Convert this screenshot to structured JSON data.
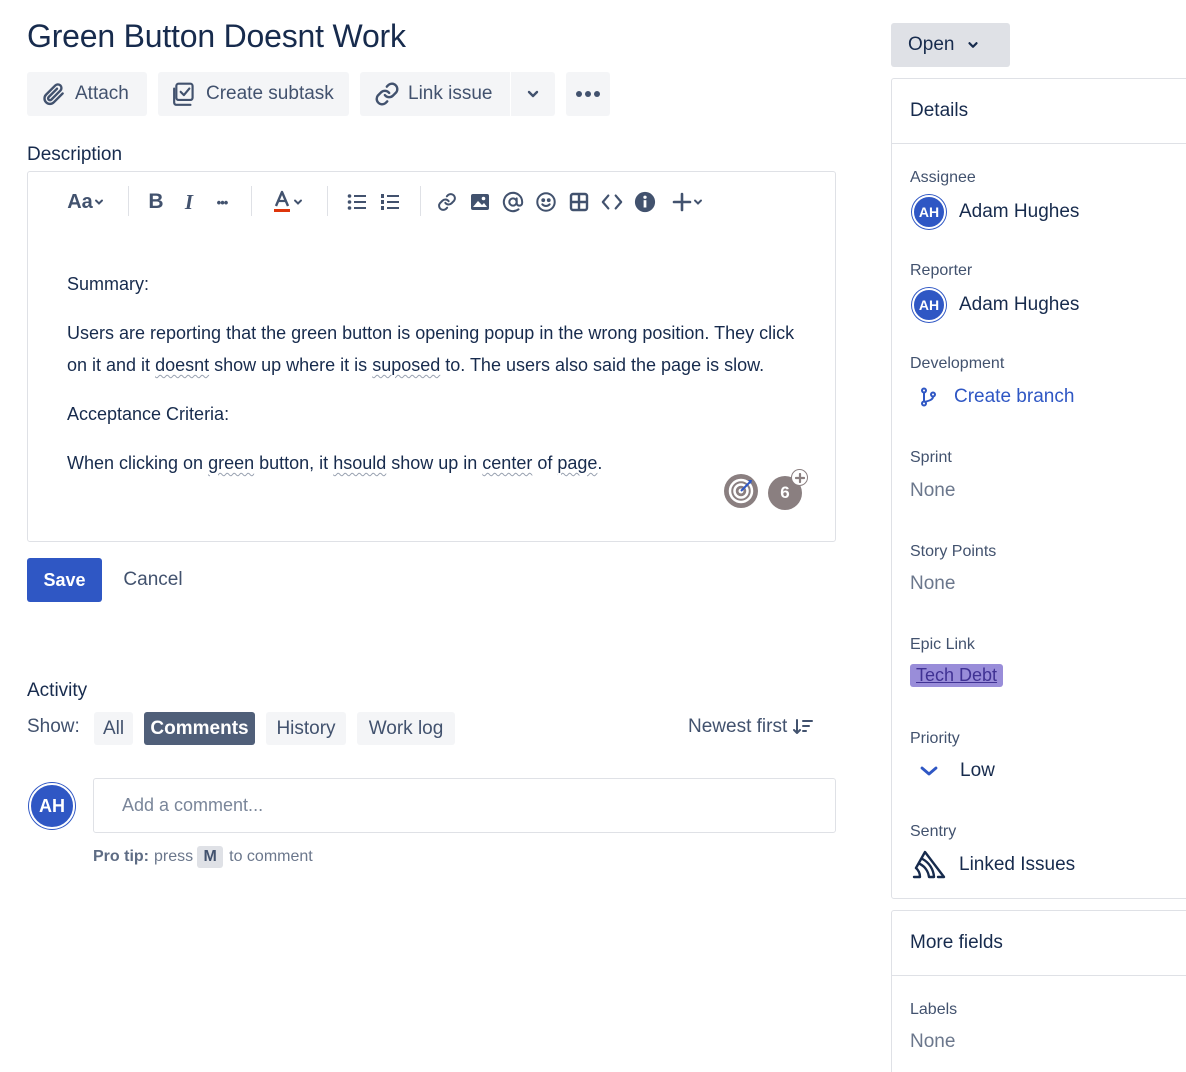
{
  "issue": {
    "title": "Green Button Doesnt Work"
  },
  "actions": {
    "attach": "Attach",
    "create_subtask": "Create subtask",
    "link_issue": "Link issue"
  },
  "description": {
    "label": "Description",
    "toolbar": {
      "text_style": "Aa",
      "bold": "B",
      "italic": "I",
      "more": "•••"
    },
    "summary_heading": "Summary:",
    "body_parts": [
      "Users are reporting that the green button is opening popup in the wrong position. They click on it and it ",
      "doesnt",
      " show up where it is ",
      "suposed",
      " to.  The users also said the page is slow."
    ],
    "acceptance_heading": "Acceptance Criteria:",
    "criteria_parts": [
      "When clicking on ",
      "green",
      " button, it ",
      "hsould",
      " show up in ",
      "center",
      " of ",
      "page",
      "."
    ],
    "collab_count": "6"
  },
  "editor_actions": {
    "save": "Save",
    "cancel": "Cancel"
  },
  "activity": {
    "label": "Activity",
    "show_label": "Show:",
    "filters": [
      "All",
      "Comments",
      "History",
      "Work log"
    ],
    "active_filter": "Comments",
    "sort_label": "Newest first",
    "comment_placeholder": "Add a comment...",
    "protip_label": "Pro tip:",
    "protip_press": "press",
    "protip_key": "M",
    "protip_suffix": "to comment",
    "user_initials": "AH"
  },
  "sidebar": {
    "status": "Open",
    "details": {
      "header": "Details",
      "assignee_label": "Assignee",
      "assignee_initials": "AH",
      "assignee_name": "Adam Hughes",
      "reporter_label": "Reporter",
      "reporter_initials": "AH",
      "reporter_name": "Adam Hughes",
      "development_label": "Development",
      "development_value": "Create branch",
      "sprint_label": "Sprint",
      "sprint_value": "None",
      "story_points_label": "Story Points",
      "story_points_value": "None",
      "epic_link_label": "Epic Link",
      "epic_link_value": "Tech Debt",
      "priority_label": "Priority",
      "priority_value": "Low",
      "sentry_label": "Sentry",
      "sentry_value": "Linked Issues"
    },
    "more_fields": {
      "header": "More fields",
      "labels_label": "Labels",
      "labels_value": "None"
    }
  },
  "colors": {
    "primary": "#2f57c4",
    "text": "#172b4d",
    "subtle_text": "#42526e",
    "neutral_bg": "#f4f5f7",
    "active_filter_bg": "#505f79",
    "epic_bg": "#998dd9"
  }
}
